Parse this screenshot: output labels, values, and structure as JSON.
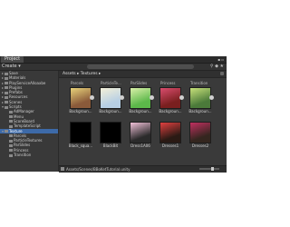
{
  "window": {
    "tab_title": "Project",
    "controls": "▪ ▫"
  },
  "toolbar": {
    "create_label": "Create ▾",
    "search_placeholder": ""
  },
  "tree": {
    "items": [
      {
        "label": "Save",
        "depth": 0,
        "arrow": "▸"
      },
      {
        "label": "Materials",
        "depth": 0,
        "arrow": "▸"
      },
      {
        "label": "PlayServiceAlloaxbe",
        "depth": 0,
        "arrow": "▸"
      },
      {
        "label": "Plugins",
        "depth": 0,
        "arrow": "▸"
      },
      {
        "label": "Prefabs",
        "depth": 0,
        "arrow": "▸"
      },
      {
        "label": "Resources",
        "depth": 0,
        "arrow": "▸"
      },
      {
        "label": "Scenes",
        "depth": 0,
        "arrow": "▸"
      },
      {
        "label": "Scripts",
        "depth": 0,
        "arrow": "▾"
      },
      {
        "label": "AdManager",
        "depth": 1,
        "arrow": ""
      },
      {
        "label": "Menu",
        "depth": 1,
        "arrow": ""
      },
      {
        "label": "ScoreBoard",
        "depth": 1,
        "arrow": ""
      },
      {
        "label": "TemplateScript",
        "depth": 1,
        "arrow": ""
      },
      {
        "label": "Texture",
        "depth": 0,
        "arrow": "▾",
        "selected": true
      },
      {
        "label": "Parcels",
        "depth": 1,
        "arrow": ""
      },
      {
        "label": "ParticleTextures",
        "depth": 1,
        "arrow": ""
      },
      {
        "label": "ParSlides",
        "depth": 1,
        "arrow": ""
      },
      {
        "label": "Princess",
        "depth": 1,
        "arrow": ""
      },
      {
        "label": "Transition",
        "depth": 1,
        "arrow": ""
      }
    ]
  },
  "breadcrumb": "Assets ▸ Textures ▸",
  "top_labels": [
    "Parcels",
    "ParticleTe...",
    "ParSlides",
    "Princess",
    "Transition"
  ],
  "assets": [
    {
      "name": "Backgroun...",
      "color": "#8a5a3a",
      "accent": "#e8d27a"
    },
    {
      "name": "Backgroun...",
      "color": "#b7cfe4",
      "accent": "#f4f0d8"
    },
    {
      "name": "Backgroun...",
      "color": "#5cb84a",
      "accent": "#d9f0a8"
    },
    {
      "name": "Backgroun...",
      "color": "#7a1f1f",
      "accent": "#d94d6e"
    },
    {
      "name": "Backgroun...",
      "color": "#4b7a3a",
      "accent": "#c7e07a"
    },
    {
      "name": "Black_squa...",
      "color": "#000000",
      "accent": "#000000"
    },
    {
      "name": "BlackBit",
      "color": "#000000",
      "accent": "#000000"
    },
    {
      "name": "Dress1A06",
      "color": "#2b2b2b",
      "accent": "#f0c0d8"
    },
    {
      "name": "Dresses1",
      "color": "#2a1a14",
      "accent": "#e04040"
    },
    {
      "name": "Dresses2",
      "color": "#34261f",
      "accent": "#c03060"
    }
  ],
  "status": {
    "path": "Assets/Scenes/BBoKetTutorial.unity"
  },
  "colors": {
    "selection": "#3d6aa8",
    "panel": "#3a3a3a",
    "dark": "#2e2e2e"
  }
}
